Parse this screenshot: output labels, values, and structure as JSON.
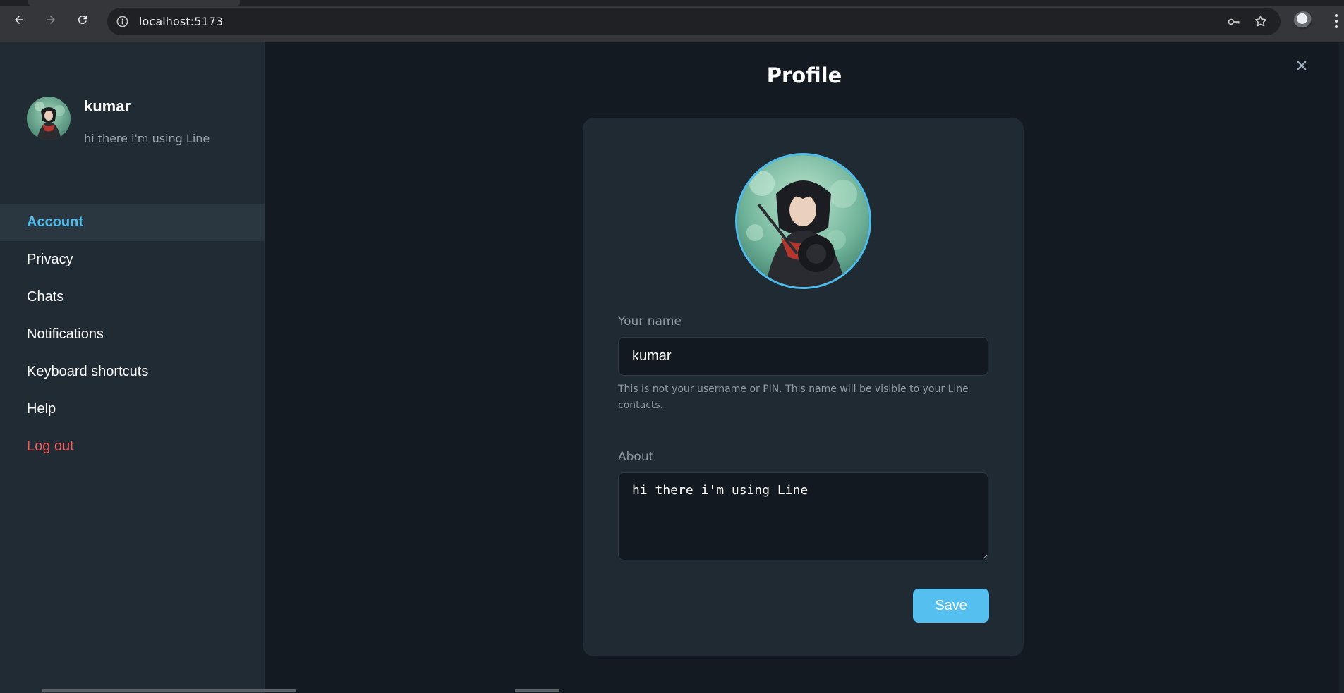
{
  "browser": {
    "url": "localhost:5173"
  },
  "sidebar": {
    "user": {
      "name": "kumar",
      "status": "hi there i'm using Line"
    },
    "items": [
      {
        "label": "Account",
        "active": true
      },
      {
        "label": "Privacy"
      },
      {
        "label": "Chats"
      },
      {
        "label": "Notifications"
      },
      {
        "label": "Keyboard shortcuts"
      },
      {
        "label": "Help"
      },
      {
        "label": "Log out",
        "danger": true
      }
    ]
  },
  "profile": {
    "title": "Profile",
    "name_label": "Your name",
    "name_value": "kumar",
    "name_hint": "This is not your username or PIN. This name will be visible to your Line contacts.",
    "about_label": "About",
    "about_value": "hi there i'm using Line",
    "save_label": "Save"
  },
  "colors": {
    "accent": "#4fbcec",
    "danger": "#f15c5c",
    "sidebar_bg": "#202b33",
    "main_bg": "#131a21",
    "card_bg": "#1f2a32"
  }
}
